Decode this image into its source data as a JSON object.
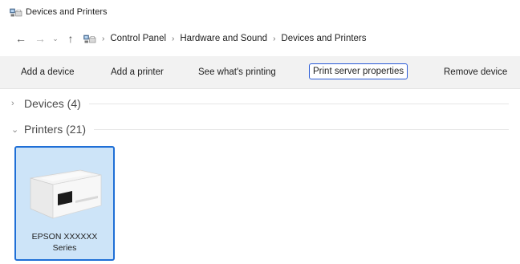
{
  "window": {
    "title": "Devices and Printers"
  },
  "address": {
    "crumbs": [
      "Control Panel",
      "Hardware and Sound",
      "Devices and Printers"
    ]
  },
  "commands": {
    "add_device": "Add a device",
    "add_printer": "Add a printer",
    "see_printing": "See what's printing",
    "print_server": "Print server properties",
    "remove_device": "Remove device"
  },
  "groups": {
    "devices": "Devices (4)",
    "printers": "Printers (21)"
  },
  "printer": {
    "name_line1": "EPSON XXXXXX",
    "name_line2": "Series"
  },
  "colors": {
    "selection_fill": "#cde4f8",
    "selection_border": "#1f6fd6",
    "focus_border": "#2a5bd7",
    "command_bar_bg": "#f2f2f2"
  },
  "icons": {
    "app": "devices-printers-icon",
    "back": "arrow-left-icon",
    "forward": "arrow-right-icon",
    "recent": "chevron-down-icon",
    "up": "arrow-up-icon",
    "location": "devices-printers-icon",
    "collapsed": "chevron-right-icon",
    "expanded": "chevron-down-icon"
  }
}
